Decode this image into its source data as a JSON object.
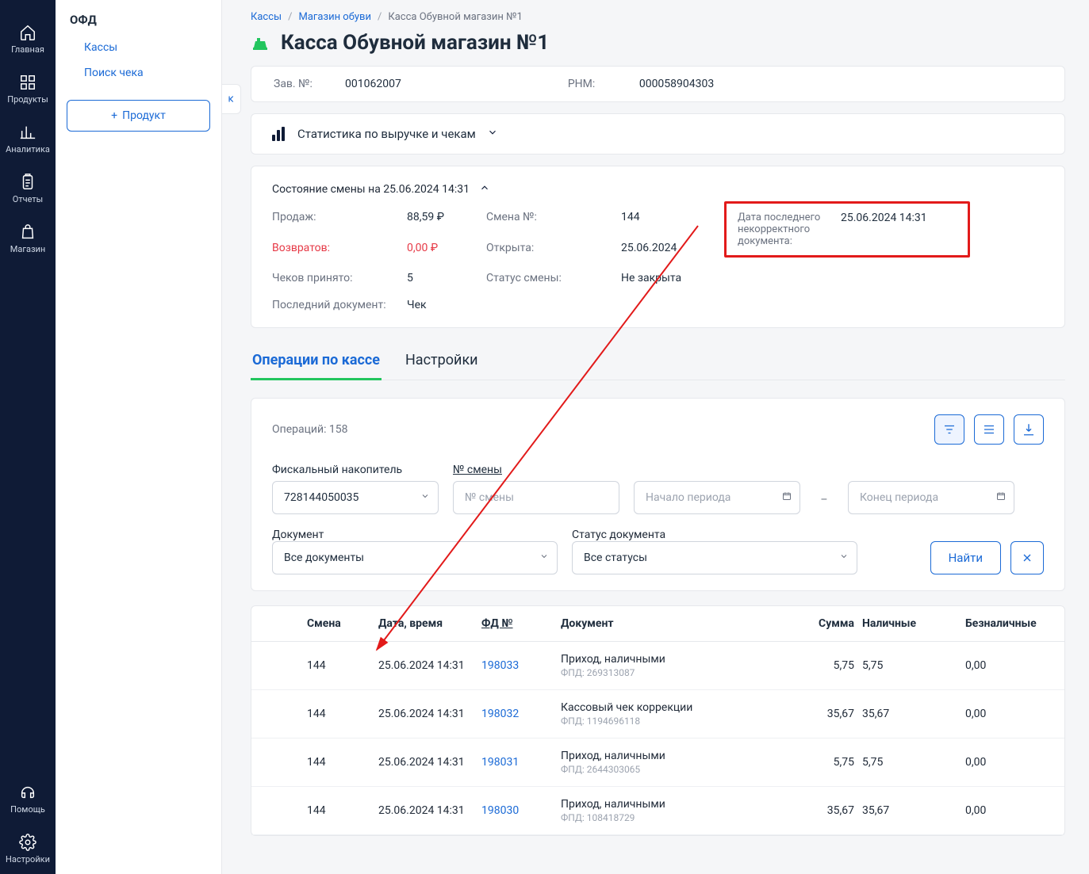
{
  "nav": {
    "items": [
      {
        "label": "Главная"
      },
      {
        "label": "Продукты"
      },
      {
        "label": "Аналитика"
      },
      {
        "label": "Отчеты"
      },
      {
        "label": "Магазин"
      }
    ],
    "bottom": [
      {
        "label": "Помощь"
      },
      {
        "label": "Настройки"
      }
    ]
  },
  "sidebar": {
    "title": "ОФД",
    "links": [
      {
        "label": "Кассы"
      },
      {
        "label": "Поиск чека"
      }
    ],
    "add_button": "Продукт"
  },
  "breadcrumb": {
    "items": [
      "Кассы",
      "Магазин обуви",
      "Касса Обувной магазин №1"
    ]
  },
  "page": {
    "title": "Касса Обувной магазин №1"
  },
  "ids": {
    "zav_label": "Зав. №:",
    "zav_value": "001062007",
    "rnm_label": "РНМ:",
    "rnm_value": "000058904303"
  },
  "stats_collapse": "Статистика по выручке и чекам",
  "shift": {
    "header": "Состояние смены на 25.06.2024 14:31",
    "rows": {
      "sales_label": "Продаж:",
      "sales_value": "88,59 ₽",
      "shift_no_label": "Смена №:",
      "shift_no_value": "144",
      "last_bad_label": "Дата последнего некорректного документа:",
      "last_bad_value": "25.06.2024 14:31",
      "returns_label": "Возвратов:",
      "returns_value": "0,00 ₽",
      "opened_label": "Открыта:",
      "opened_value": "25.06.2024",
      "checks_label": "Чеков принято:",
      "checks_value": "5",
      "status_label": "Статус смены:",
      "status_value": "Не закрыта",
      "lastdoc_label": "Последний документ:",
      "lastdoc_value": "Чек"
    }
  },
  "tabs": {
    "ops": "Операции по кассе",
    "settings": "Настройки"
  },
  "ops": {
    "count_label": "Операций: 158",
    "filters": {
      "fn_label": "Фискальный накопитель",
      "fn_value": "728144050035",
      "shift_label": "№ смены",
      "shift_placeholder": "№ смены",
      "period_start": "Начало периода",
      "period_end": "Конец периода",
      "doc_label": "Документ",
      "doc_value": "Все документы",
      "status_label": "Статус документа",
      "status_value": "Все статусы",
      "search_btn": "Найти"
    },
    "table": {
      "headers": {
        "shift": "Смена",
        "dt": "Дата, время",
        "fd": "ФД №",
        "doc": "Документ",
        "sum": "Сумма",
        "cash": "Наличные",
        "noncash": "Безналичные"
      },
      "rows": [
        {
          "shift": "144",
          "dt": "25.06.2024 14:31",
          "fd": "198033",
          "doc": "Приход, наличными",
          "fpd": "ФПД: 269313087",
          "sum": "5,75",
          "cash": "5,75",
          "noncash": "0,00"
        },
        {
          "shift": "144",
          "dt": "25.06.2024 14:31",
          "fd": "198032",
          "doc": "Кассовый чек коррекции",
          "fpd": "ФПД: 1194696118",
          "sum": "35,67",
          "cash": "35,67",
          "noncash": "0,00"
        },
        {
          "shift": "144",
          "dt": "25.06.2024 14:31",
          "fd": "198031",
          "doc": "Приход, наличными",
          "fpd": "ФПД: 2644303065",
          "sum": "5,75",
          "cash": "5,75",
          "noncash": "0,00"
        },
        {
          "shift": "144",
          "dt": "25.06.2024 14:31",
          "fd": "198030",
          "doc": "Приход, наличными",
          "fpd": "ФПД: 108418729",
          "sum": "35,67",
          "cash": "35,67",
          "noncash": "0,00"
        }
      ]
    }
  }
}
